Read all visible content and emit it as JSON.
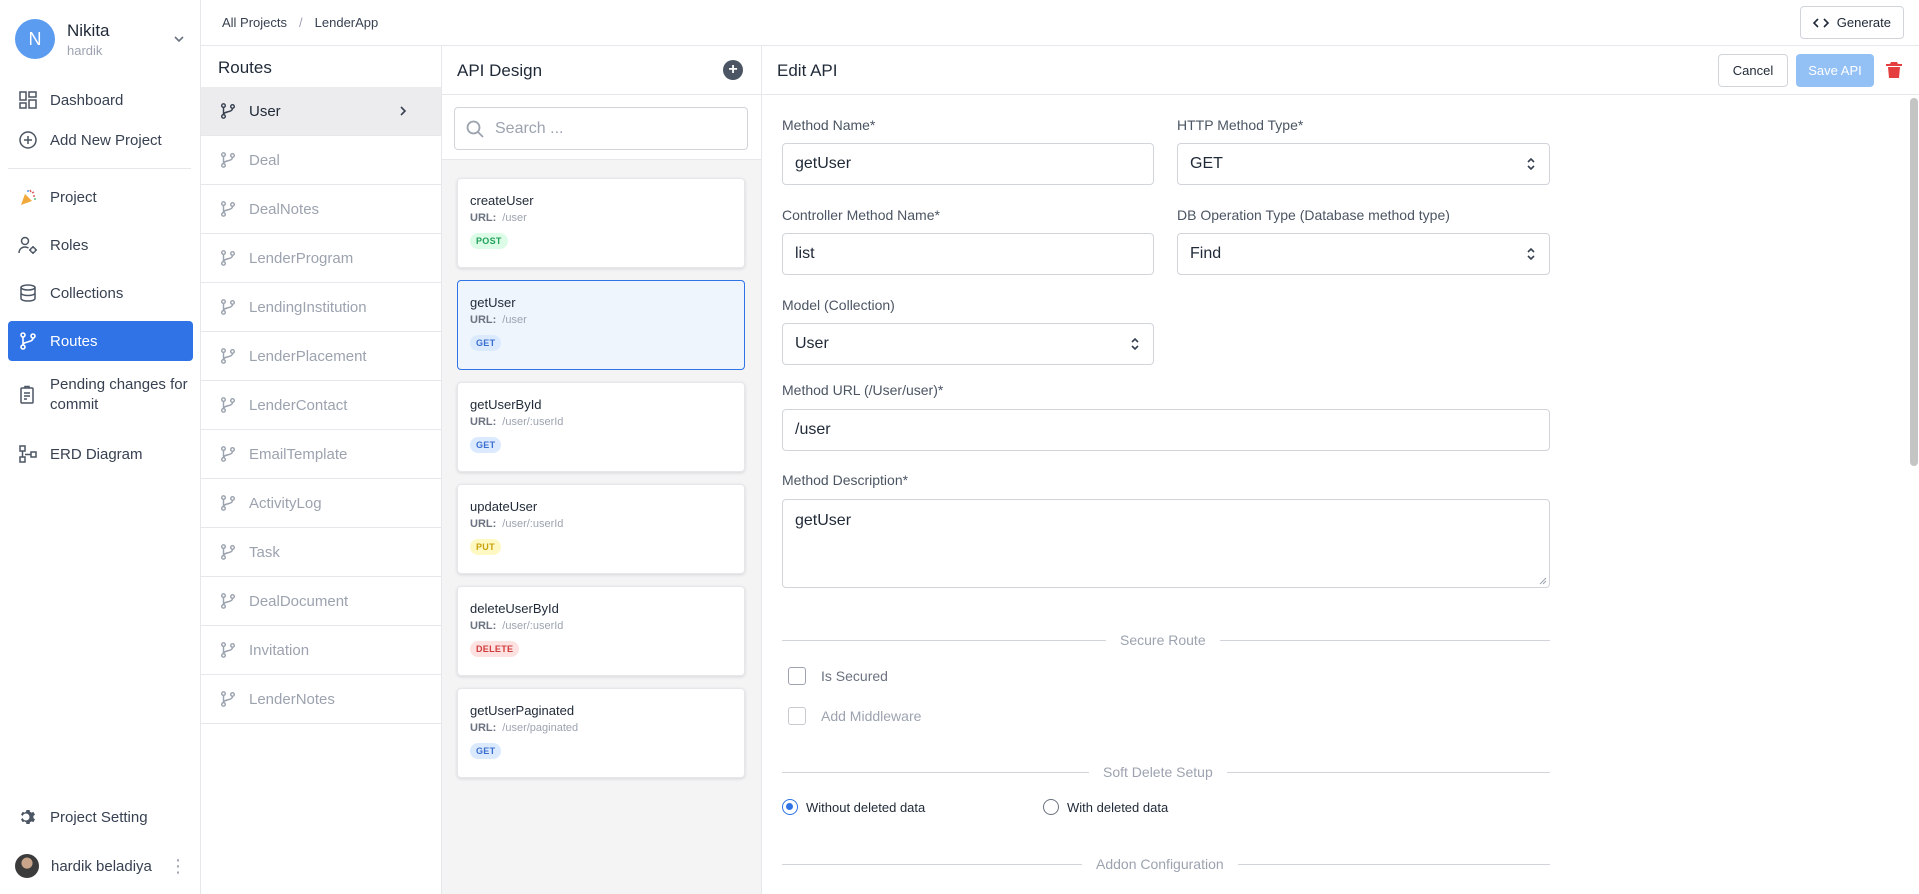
{
  "user": {
    "initial": "N",
    "name": "Nikita",
    "sub": "hardik"
  },
  "nav": {
    "dashboard": "Dashboard",
    "add_project": "Add New Project",
    "project": "Project",
    "roles": "Roles",
    "collections": "Collections",
    "routes": "Routes",
    "pending_line1": "Pending changes for",
    "pending_line2": "commit",
    "erd": "ERD Diagram",
    "project_setting": "Project Setting",
    "bottom_user": "hardik beladiya"
  },
  "breadcrumb": {
    "root": "All Projects",
    "separator": "/",
    "current": "LenderApp"
  },
  "topbar": {
    "generate_label": "Generate"
  },
  "routes_panel": {
    "title": "Routes",
    "items": [
      "User",
      "Deal",
      "DealNotes",
      "LenderProgram",
      "LendingInstitution",
      "LenderPlacement",
      "LenderContact",
      "EmailTemplate",
      "ActivityLog",
      "Task",
      "DealDocument",
      "Invitation",
      "LenderNotes"
    ]
  },
  "api_panel": {
    "title": "API Design",
    "add_symbol": "+",
    "search_placeholder": "Search ...",
    "url_prefix": "URL:",
    "apis": [
      {
        "name": "createUser",
        "url": "/user",
        "method": "POST"
      },
      {
        "name": "getUser",
        "url": "/user",
        "method": "GET"
      },
      {
        "name": "getUserById",
        "url": "/user/:userId",
        "method": "GET"
      },
      {
        "name": "updateUser",
        "url": "/user/:userId",
        "method": "PUT"
      },
      {
        "name": "deleteUserById",
        "url": "/user/:userId",
        "method": "DELETE"
      },
      {
        "name": "getUserPaginated",
        "url": "/user/paginated",
        "method": "GET"
      }
    ]
  },
  "edit": {
    "title": "Edit API",
    "cancel_label": "Cancel",
    "save_label": "Save API",
    "method_name_label": "Method Name*",
    "method_name_value": "getUser",
    "http_type_label": "HTTP Method Type*",
    "http_type_value": "GET",
    "controller_label": "Controller Method Name*",
    "controller_value": "list",
    "db_op_label": "DB Operation Type (Database method type)",
    "db_op_value": "Find",
    "model_label": "Model (Collection)",
    "model_value": "User",
    "url_label": "Method URL (/User/user)*",
    "url_value": "/user",
    "desc_label": "Method Description*",
    "desc_value": "getUser",
    "secure_section": "Secure Route",
    "is_secured": "Is Secured",
    "add_middleware": "Add Middleware",
    "soft_delete_section": "Soft Delete Setup",
    "without_deleted": "Without deleted data",
    "with_deleted": "With deleted data",
    "addon_section": "Addon Configuration"
  },
  "colors": {
    "accent": "#2f73e6",
    "save_disabled": "#93c0f5",
    "danger": "#e53e3e"
  }
}
